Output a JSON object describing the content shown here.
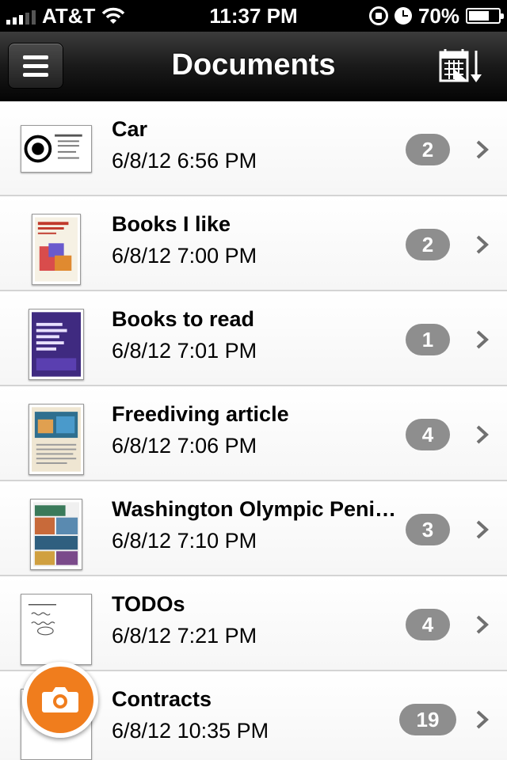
{
  "status_bar": {
    "carrier": "AT&T",
    "time": "11:37 PM",
    "battery": "70%",
    "battery_level": 0.7,
    "icons": [
      "signal-icon",
      "wifi-icon",
      "orientation-lock-icon",
      "alarm-icon",
      "battery-icon"
    ]
  },
  "nav": {
    "title": "Documents",
    "left_icon": "menu-icon",
    "right_icon": "calendar-sort-icon"
  },
  "documents": [
    {
      "title": "Car",
      "date": "6/8/12 6:56 PM",
      "count": "2"
    },
    {
      "title": "Books I like",
      "date": "6/8/12 7:00 PM",
      "count": "2"
    },
    {
      "title": "Books to read",
      "date": "6/8/12 7:01 PM",
      "count": "1"
    },
    {
      "title": "Freediving article",
      "date": "6/8/12 7:06 PM",
      "count": "4"
    },
    {
      "title": "Washington Olympic Peni…",
      "date": "6/8/12 7:10 PM",
      "count": "3"
    },
    {
      "title": "TODOs",
      "date": "6/8/12 7:21 PM",
      "count": "4"
    },
    {
      "title": "Contracts",
      "date": "6/8/12 10:35 PM",
      "count": "19"
    }
  ],
  "fab": {
    "icon": "camera-icon"
  },
  "colors": {
    "accent": "#f07d1d",
    "badge": "#8e8e8e",
    "nav_bg": "#1a1a1a"
  }
}
